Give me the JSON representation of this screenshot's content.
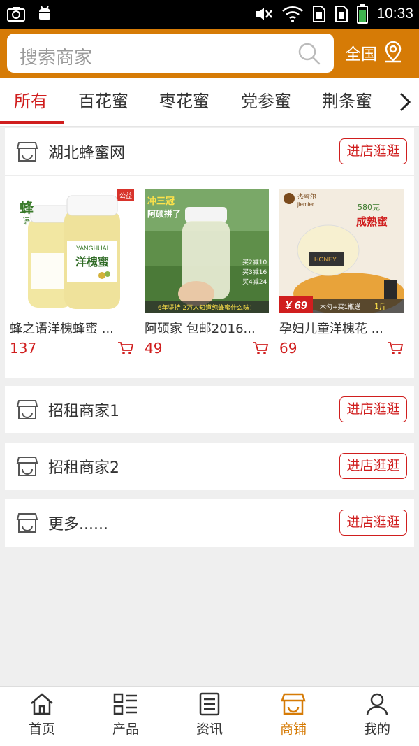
{
  "status_bar": {
    "time": "10:33"
  },
  "header": {
    "search_placeholder": "搜索商家",
    "region_label": "全国",
    "accent_color": "#d67b06"
  },
  "tabs": [
    {
      "label": "所有",
      "active": true
    },
    {
      "label": "百花蜜"
    },
    {
      "label": "枣花蜜"
    },
    {
      "label": "党参蜜"
    },
    {
      "label": "荆条蜜"
    }
  ],
  "stores": [
    {
      "name": "湖北蜂蜜网",
      "visit_label": "进店逛逛",
      "products": [
        {
          "name": "蜂之语洋槐蜂蜜 ...",
          "price": "137",
          "img": {
            "brand_cn": "蜂",
            "brand_sub": "语",
            "en": "YANGHUAI",
            "cn": "洋槐蜜",
            "corner": "公益"
          }
        },
        {
          "name": "阿硕家 包邮2016...",
          "price": "49",
          "img": {
            "title": "冲三冠",
            "sub": "阿硕拼了",
            "deals": [
              "买2减10",
              "买3减16",
              "买4减24"
            ],
            "banner": "6年坚持 2万人知道纯蜂蜜什么味！"
          }
        },
        {
          "name": "孕妇儿童洋槐花 ...",
          "price": "69",
          "img": {
            "brand": "杰蜜尔",
            "brand_en": "jiemier",
            "weight": "580克",
            "slogan": "成熟蜜",
            "label": "HONEY",
            "price": "¥ 69",
            "promo": "木勺+买1瓶送",
            "promo_tail": "1斤"
          }
        }
      ]
    },
    {
      "name": "招租商家1",
      "visit_label": "进店逛逛"
    },
    {
      "name": "招租商家2",
      "visit_label": "进店逛逛"
    },
    {
      "name": "更多......",
      "visit_label": "进店逛逛"
    }
  ],
  "bottom_nav": [
    {
      "label": "首页",
      "icon": "home-icon"
    },
    {
      "label": "产品",
      "icon": "list-icon"
    },
    {
      "label": "资讯",
      "icon": "news-icon"
    },
    {
      "label": "商铺",
      "icon": "shop-icon",
      "active": true
    },
    {
      "label": "我的",
      "icon": "user-icon"
    }
  ]
}
